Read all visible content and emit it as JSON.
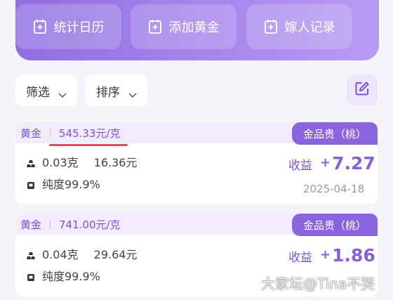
{
  "top_actions": [
    {
      "label": "统计日历",
      "icon": "calendar-plus-icon"
    },
    {
      "label": "添加黄金",
      "icon": "add-document-icon"
    },
    {
      "label": "嫁人记录",
      "icon": "add-document-icon"
    }
  ],
  "filters": {
    "filter_label": "筛选",
    "sort_label": "排序",
    "edit_icon": "edit-icon"
  },
  "records": [
    {
      "metal": "黄金",
      "unit_price": "545.33元/克",
      "store": "金品贵（桃）",
      "weight": "0.03克",
      "cost": "16.36元",
      "purity": "纯度99.9%",
      "income_label": "收益",
      "income_sign": "+",
      "income_value": "7.27",
      "date": "2025-04-18"
    },
    {
      "metal": "黄金",
      "unit_price": "741.00元/克",
      "store": "金品贵（桃）",
      "weight": "0.04克",
      "cost": "29.64元",
      "purity": "纯度99.9%",
      "income_label": "收益",
      "income_sign": "+",
      "income_value": "1.86"
    }
  ],
  "colors": {
    "accent": "#8a64dc",
    "highlight_underline": "#e04b5b"
  },
  "watermark": "大家坛@Tina不哭"
}
